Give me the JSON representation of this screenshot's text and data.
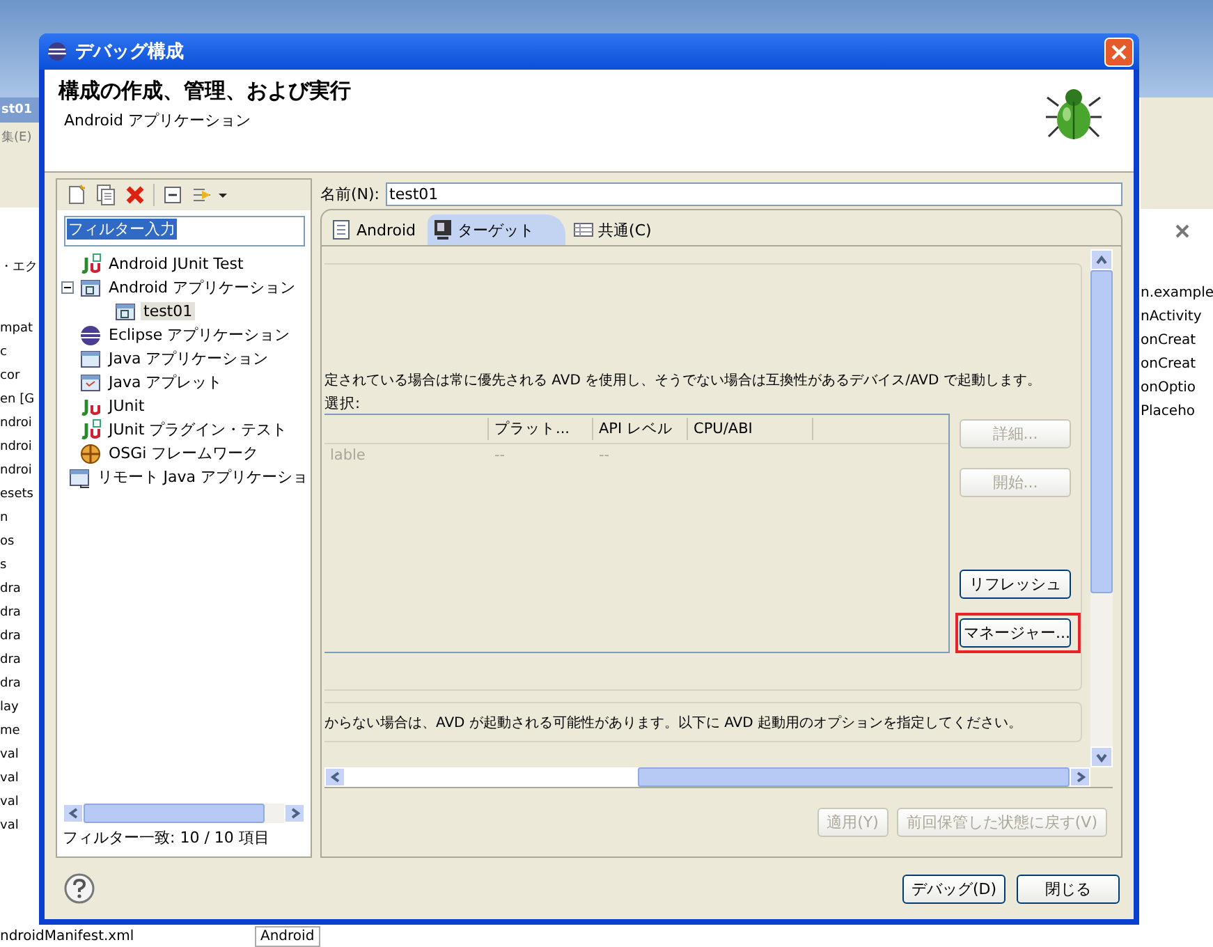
{
  "background": {
    "window_title": "st01",
    "menu": "集(E)",
    "explorer_label": "・エク",
    "explorer_items": [
      "mpat",
      "c",
      "cor",
      "en [G",
      "ndroi",
      "ndroi",
      "ndroi",
      "esets",
      "n",
      "os",
      "s",
      "dra",
      "dra",
      "dra",
      "dra",
      "dra",
      "lay",
      "me",
      "val",
      "val",
      "val",
      "val"
    ],
    "manifest_file": "ndroidManifest.xml",
    "editor_tab": "Android",
    "outline_items": [
      "n.example",
      "nActivity",
      "onCreat",
      "onCreat",
      "onOptio",
      "Placeho"
    ]
  },
  "dialog": {
    "title": "デバッグ構成",
    "header": {
      "title": "構成の作成、管理、および実行",
      "subtitle": "Android アプリケーション"
    },
    "filter": {
      "value": "フィルター入力",
      "selected": true
    },
    "tree": [
      {
        "label": "Android JUnit Test",
        "kind": "junit-android",
        "selected": false
      },
      {
        "label": "Android アプリケーション",
        "kind": "android-app",
        "selected": false,
        "expanded": true,
        "children": [
          {
            "label": "test01",
            "kind": "android-app",
            "selected": true
          }
        ]
      },
      {
        "label": "Eclipse アプリケーション",
        "kind": "eclipse",
        "selected": false
      },
      {
        "label": "Java アプリケーション",
        "kind": "java-app",
        "selected": false
      },
      {
        "label": "Java アプレット",
        "kind": "applet",
        "selected": false
      },
      {
        "label": "JUnit",
        "kind": "junit",
        "selected": false
      },
      {
        "label": "JUnit プラグイン・テスト",
        "kind": "junit-plugin",
        "selected": false
      },
      {
        "label": "OSGi フレームワーク",
        "kind": "osgi",
        "selected": false
      },
      {
        "label": "リモート Java アプリケーショ",
        "kind": "remote-java",
        "selected": false
      }
    ],
    "filter_status": "フィルター一致: 10 / 10 項目",
    "name_label": "名前(N):",
    "name_value": "test01",
    "tabs": [
      {
        "label": "Android",
        "kind": "page",
        "selected": false
      },
      {
        "label": "ターゲット",
        "kind": "monitor",
        "selected": true
      },
      {
        "label": "共通(C)",
        "kind": "table",
        "selected": false
      }
    ],
    "target_note": "定されている場合は常に優先される AVD を使用し、そうでない場合は互換性があるデバイス/AVD で起動します。",
    "select_label": "選択:",
    "table": {
      "columns": [
        "",
        "プラット...",
        "API レベル",
        "CPU/ABI"
      ],
      "rows": [
        {
          "cells": [
            "lable",
            "--",
            "--"
          ]
        }
      ]
    },
    "side_buttons": [
      {
        "label": "詳細...",
        "disabled": true,
        "highlighted": false
      },
      {
        "label": "開始...",
        "disabled": true,
        "highlighted": false
      },
      {
        "label": "リフレッシュ",
        "disabled": false,
        "highlighted": false
      },
      {
        "label": "マネージャー...",
        "disabled": false,
        "highlighted": true
      }
    ],
    "options_note": "からない場合は、AVD が起動される可能性があります。以下に AVD 起動用のオプションを指定してください。",
    "apply_buttons": [
      {
        "label": "適用(Y)",
        "disabled": true
      },
      {
        "label": "前回保管した状態に戻す(V)",
        "disabled": true
      }
    ],
    "footer_buttons": [
      "デバッグ(D)",
      "閉じる"
    ]
  }
}
